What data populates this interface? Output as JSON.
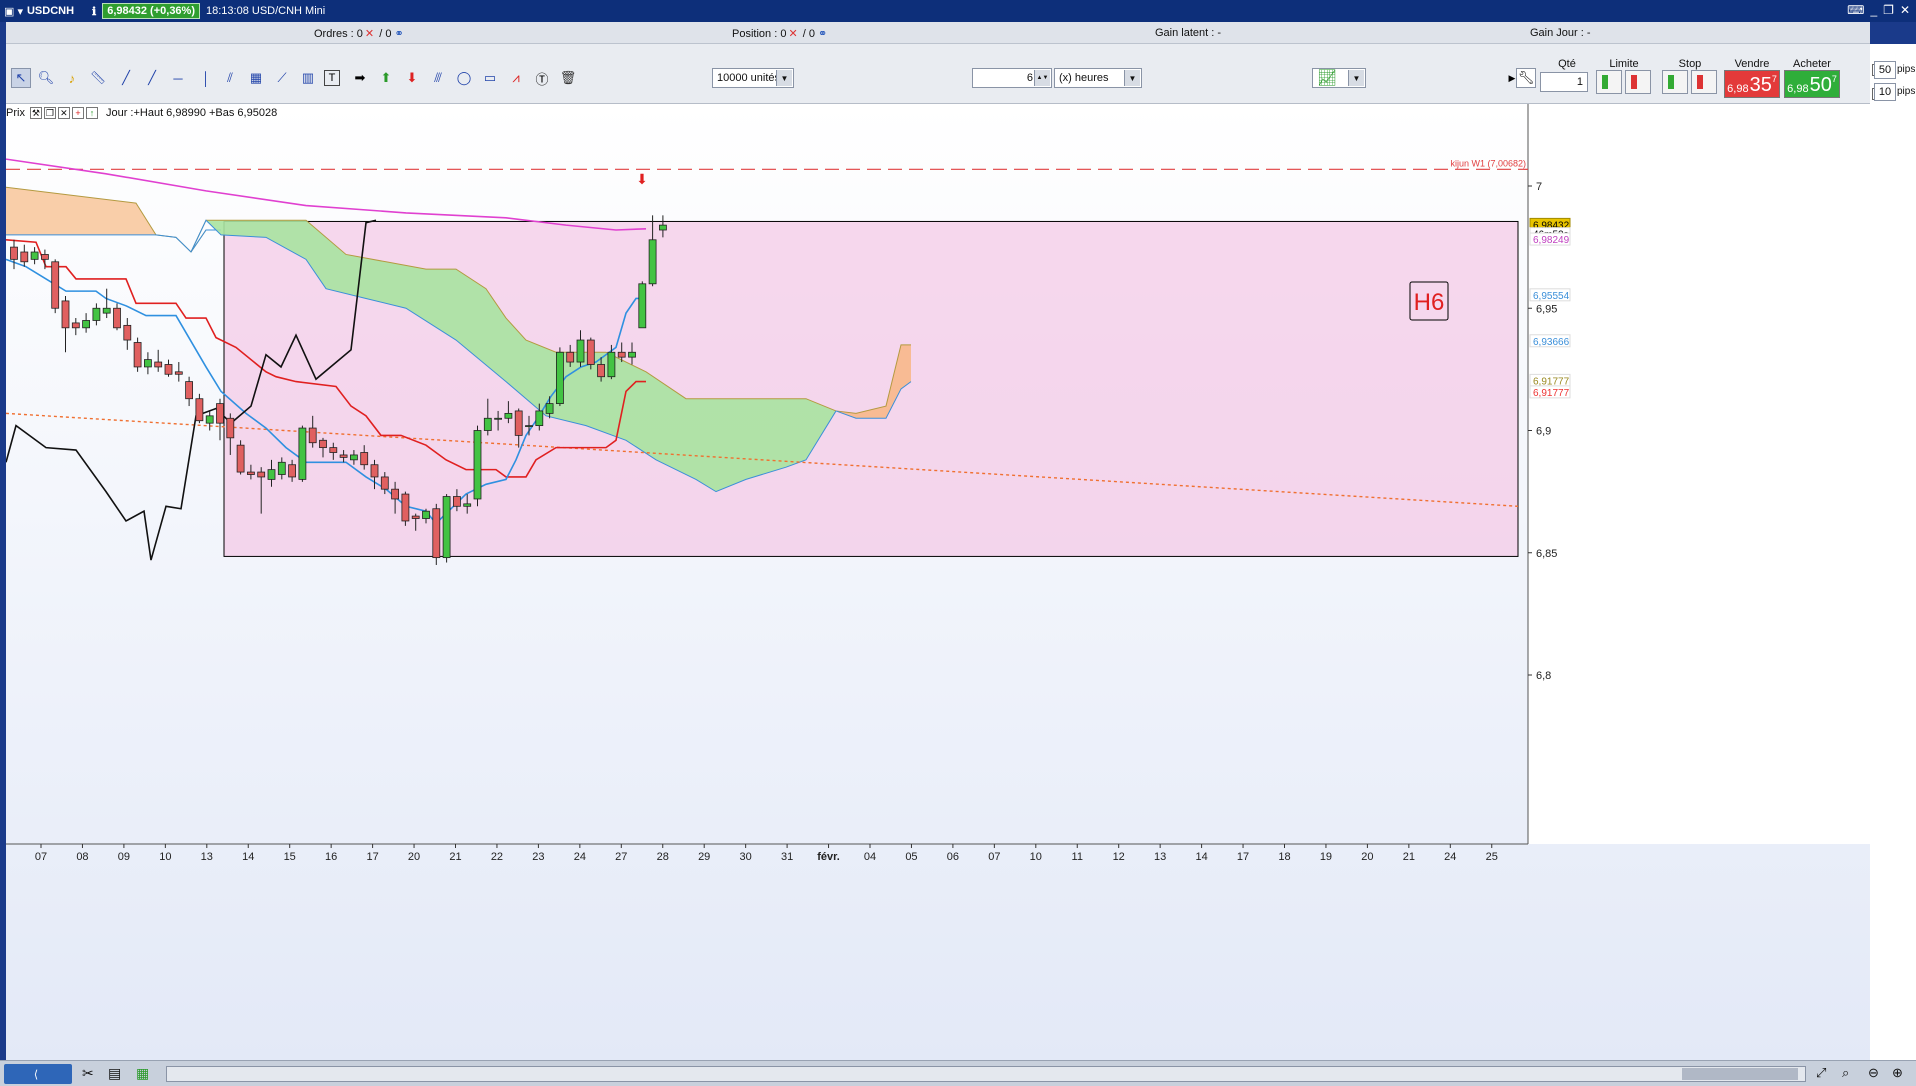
{
  "window": {
    "symbol": "USDCNH",
    "price_change": "6,98432 (+0,36%)",
    "time_title": "18:13:08 USD/CNH Mini"
  },
  "infobar": {
    "orders_label": "Ordres :",
    "orders_a": "0",
    "orders_b": "/ 0",
    "position_label": "Position :",
    "position_a": "0",
    "position_b": "/ 0",
    "gain_latent": "Gain latent :  -",
    "gain_jour": "Gain Jour :  -"
  },
  "toolbar": {
    "units": "10000 unités",
    "period_value": "6",
    "period_unit": "(x) heures",
    "qte_label": "Qté",
    "qte_value": "1",
    "limite_label": "Limite",
    "stop_label": "Stop",
    "vendre_label": "Vendre",
    "acheter_label": "Acheter",
    "sell_small": "6,98",
    "sell_big": "35",
    "sell_sup": "7",
    "buy_small": "6,98",
    "buy_big": "50",
    "buy_sup": "7",
    "s_label": "S",
    "s_pips": "50",
    "l_label": "L",
    "l_pips": "10",
    "pips_label": "pips"
  },
  "chart_header": {
    "prix_label": "Prix",
    "jour_info": "Jour :+Haut 6,98990 +Bas 6,95028"
  },
  "chart_data": {
    "type": "candlestick",
    "symbol": "USDCNH",
    "timeframe_hours": 6,
    "ylim": [
      6.77,
      7.05
    ],
    "y_ticks": [
      {
        "v": 7.0,
        "label": "7"
      },
      {
        "v": 6.95,
        "label": "6,95"
      },
      {
        "v": 6.9,
        "label": "6,9"
      },
      {
        "v": 6.85,
        "label": "6,85"
      },
      {
        "v": 6.8,
        "label": "6,8"
      }
    ],
    "x_labels": [
      "07",
      "08",
      "09",
      "10",
      "13",
      "14",
      "15",
      "16",
      "17",
      "20",
      "21",
      "22",
      "23",
      "24",
      "27",
      "28",
      "29",
      "30",
      "31",
      "févr.",
      "04",
      "05",
      "06",
      "07",
      "10",
      "11",
      "12",
      "13",
      "14",
      "17",
      "18",
      "19",
      "20",
      "21",
      "24",
      "25"
    ],
    "price_tags": [
      {
        "label": "6,98432",
        "v": 6.9843,
        "color": "#e8c400",
        "text": "#000"
      },
      {
        "label": "46m52s",
        "v": 6.9805,
        "color": "#ffffff",
        "text": "#000"
      },
      {
        "label": "6,98249",
        "v": 6.9783,
        "color": "#ffffff",
        "text": "#c040c0"
      },
      {
        "label": "6,95554",
        "v": 6.9555,
        "color": "#ffffff",
        "text": "#3b8fd9"
      },
      {
        "label": "6,93666",
        "v": 6.9367,
        "color": "#ffffff",
        "text": "#3b8fd9"
      },
      {
        "label": "6,91777",
        "v": 6.9205,
        "color": "#ffffff",
        "text": "#9a8a20"
      },
      {
        "label": "6,91777",
        "v": 6.9158,
        "color": "#ffffff",
        "text": "#e33"
      }
    ],
    "kijun_w1_label": "kijun W1 (7,00682)",
    "kijun_w1": 7.00682,
    "box": {
      "x0": 218,
      "x1": 1512,
      "y_top": 6.9855,
      "y_bottom": 6.8485,
      "label": "H6"
    },
    "candles": [
      [
        6.975,
        6.97,
        6.978,
        6.966
      ],
      [
        6.973,
        6.969,
        6.976,
        6.967
      ],
      [
        6.97,
        6.973,
        6.975,
        6.968
      ],
      [
        6.972,
        6.97,
        6.974,
        6.966
      ],
      [
        6.969,
        6.95,
        6.97,
        6.948
      ],
      [
        6.953,
        6.942,
        6.955,
        6.932
      ],
      [
        6.944,
        6.942,
        6.946,
        6.939
      ],
      [
        6.942,
        6.945,
        6.948,
        6.94
      ],
      [
        6.945,
        6.95,
        6.952,
        6.943
      ],
      [
        6.948,
        6.95,
        6.958,
        6.946
      ],
      [
        6.95,
        6.942,
        6.952,
        6.941
      ],
      [
        6.943,
        6.937,
        6.946,
        6.933
      ],
      [
        6.936,
        6.926,
        6.938,
        6.924
      ],
      [
        6.926,
        6.929,
        6.932,
        6.923
      ],
      [
        6.928,
        6.926,
        6.933,
        6.924
      ],
      [
        6.927,
        6.923,
        6.929,
        6.922
      ],
      [
        6.924,
        6.923,
        6.928,
        6.92
      ],
      [
        6.92,
        6.913,
        6.922,
        6.91
      ],
      [
        6.913,
        6.904,
        6.915,
        6.903
      ],
      [
        6.903,
        6.906,
        6.908,
        6.9
      ],
      [
        6.911,
        6.903,
        6.913,
        6.896
      ],
      [
        6.905,
        6.897,
        6.907,
        6.89
      ],
      [
        6.894,
        6.883,
        6.896,
        6.882
      ],
      [
        6.883,
        6.882,
        6.886,
        6.88
      ],
      [
        6.883,
        6.881,
        6.885,
        6.866
      ],
      [
        6.88,
        6.884,
        6.888,
        6.877
      ],
      [
        6.882,
        6.887,
        6.889,
        6.88
      ],
      [
        6.886,
        6.881,
        6.888,
        6.879
      ],
      [
        6.88,
        6.901,
        6.902,
        6.879
      ],
      [
        6.901,
        6.895,
        6.906,
        6.893
      ],
      [
        6.896,
        6.893,
        6.897,
        6.889
      ],
      [
        6.893,
        6.891,
        6.895,
        6.888
      ],
      [
        6.89,
        6.889,
        6.892,
        6.887
      ],
      [
        6.888,
        6.89,
        6.892,
        6.886
      ],
      [
        6.891,
        6.886,
        6.894,
        6.884
      ],
      [
        6.886,
        6.881,
        6.888,
        6.876
      ],
      [
        6.881,
        6.876,
        6.883,
        6.874
      ],
      [
        6.876,
        6.872,
        6.879,
        6.866
      ],
      [
        6.874,
        6.863,
        6.875,
        6.861
      ],
      [
        6.865,
        6.864,
        6.866,
        6.859
      ],
      [
        6.864,
        6.867,
        6.868,
        6.862
      ],
      [
        6.868,
        6.848,
        6.87,
        6.845
      ],
      [
        6.848,
        6.873,
        6.874,
        6.846
      ],
      [
        6.873,
        6.869,
        6.876,
        6.867
      ],
      [
        6.869,
        6.87,
        6.874,
        6.866
      ],
      [
        6.872,
        6.9,
        6.902,
        6.869
      ],
      [
        6.9,
        6.905,
        6.913,
        6.898
      ],
      [
        6.905,
        6.905,
        6.908,
        6.9
      ],
      [
        6.905,
        6.907,
        6.912,
        6.903
      ],
      [
        6.908,
        6.898,
        6.909,
        6.893
      ],
      [
        6.902,
        6.902,
        6.906,
        6.898
      ],
      [
        6.902,
        6.908,
        6.911,
        6.9
      ],
      [
        6.907,
        6.911,
        6.914,
        6.905
      ],
      [
        6.911,
        6.932,
        6.934,
        6.91
      ],
      [
        6.932,
        6.928,
        6.935,
        6.926
      ],
      [
        6.928,
        6.937,
        6.941,
        6.926
      ],
      [
        6.937,
        6.927,
        6.938,
        6.925
      ],
      [
        6.927,
        6.922,
        6.93,
        6.92
      ],
      [
        6.922,
        6.932,
        6.935,
        6.921
      ],
      [
        6.932,
        6.93,
        6.936,
        6.928
      ],
      [
        6.93,
        6.932,
        6.936,
        6.927
      ],
      [
        6.942,
        6.96,
        6.961,
        6.954
      ],
      [
        6.96,
        6.978,
        6.988,
        6.959
      ],
      [
        6.982,
        6.984,
        6.988,
        6.979
      ]
    ]
  }
}
